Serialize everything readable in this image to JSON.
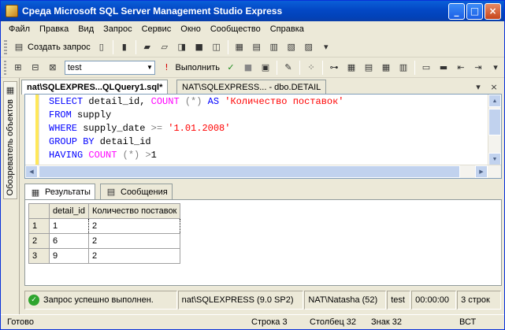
{
  "window": {
    "title": "Среда Microsoft SQL Server Management Studio Express",
    "controls": {
      "minimize": "_",
      "maximize": "□",
      "close": "×"
    }
  },
  "menu": [
    "Файл",
    "Правка",
    "Вид",
    "Запрос",
    "Сервис",
    "Окно",
    "Сообщество",
    "Справка"
  ],
  "toolbar1": {
    "new_query_label": "Создать запрос",
    "icons": [
      "new-query-icon",
      "new-file-icon",
      "open-project-icon",
      "open-file-icon",
      "save-icon",
      "save-all-icon",
      "registered-servers-icon",
      "object-explorer-icon",
      "template-explorer-icon",
      "properties-icon"
    ]
  },
  "toolbar2": {
    "database": "test",
    "execute_label": "Выполнить",
    "icons": [
      "connect-icon",
      "change-connection-icon",
      "disconnect-icon",
      "execute-icon",
      "parse-icon",
      "cancel-icon",
      "display-plan-icon",
      "results-to-text-icon",
      "results-to-grid-icon",
      "results-to-file-icon"
    ]
  },
  "sidebar": {
    "object_explorer_label": "Обозреватель объектов"
  },
  "doc_tabs": [
    {
      "label": "nat\\SQLEXPRES...QLQuery1.sql*",
      "active": true
    },
    {
      "label": "NAT\\SQLEXPRESS... - dbo.DETAIL",
      "active": false
    }
  ],
  "editor": {
    "lines": [
      [
        [
          "kw",
          "SELECT"
        ],
        [
          "t",
          " detail_id, "
        ],
        [
          "fn",
          "COUNT"
        ],
        [
          "t",
          " "
        ],
        [
          "op",
          "(*)"
        ],
        [
          "t",
          " "
        ],
        [
          "kw",
          "AS"
        ],
        [
          "t",
          " "
        ],
        [
          "str",
          "'Количество поставок'"
        ]
      ],
      [
        [
          "kw",
          "FROM"
        ],
        [
          "t",
          " supply"
        ]
      ],
      [
        [
          "kw",
          "WHERE"
        ],
        [
          "t",
          " supply_date "
        ],
        [
          "op",
          ">="
        ],
        [
          "t",
          " "
        ],
        [
          "str",
          "'1.01.2008'"
        ]
      ],
      [
        [
          "kw",
          "GROUP BY"
        ],
        [
          "t",
          " detail_id"
        ]
      ],
      [
        [
          "kw",
          "HAVING"
        ],
        [
          "t",
          " "
        ],
        [
          "fn",
          "COUNT"
        ],
        [
          "t",
          " "
        ],
        [
          "op",
          "(*)"
        ],
        [
          "t",
          " "
        ],
        [
          "op",
          ">"
        ],
        [
          "t",
          "1"
        ]
      ]
    ]
  },
  "result_tabs": [
    {
      "label": "Результаты",
      "active": true
    },
    {
      "label": "Сообщения",
      "active": false
    }
  ],
  "results": {
    "columns": [
      "detail_id",
      "Количество поставок"
    ],
    "rows": [
      {
        "num": "1",
        "cells": [
          "1",
          "2"
        ]
      },
      {
        "num": "2",
        "cells": [
          "6",
          "2"
        ]
      },
      {
        "num": "3",
        "cells": [
          "9",
          "2"
        ]
      }
    ]
  },
  "query_status": {
    "message": "Запрос успешно выполнен.",
    "server": "nat\\SQLEXPRESS (9.0 SP2)",
    "user": "NAT\\Natasha (52)",
    "database": "test",
    "elapsed": "00:00:00",
    "rows": "3 строк"
  },
  "statusbar": {
    "ready": "Готово",
    "line": "Строка 3",
    "column": "Столбец 32",
    "char": "Знак 32",
    "mode": "ВСТ"
  }
}
